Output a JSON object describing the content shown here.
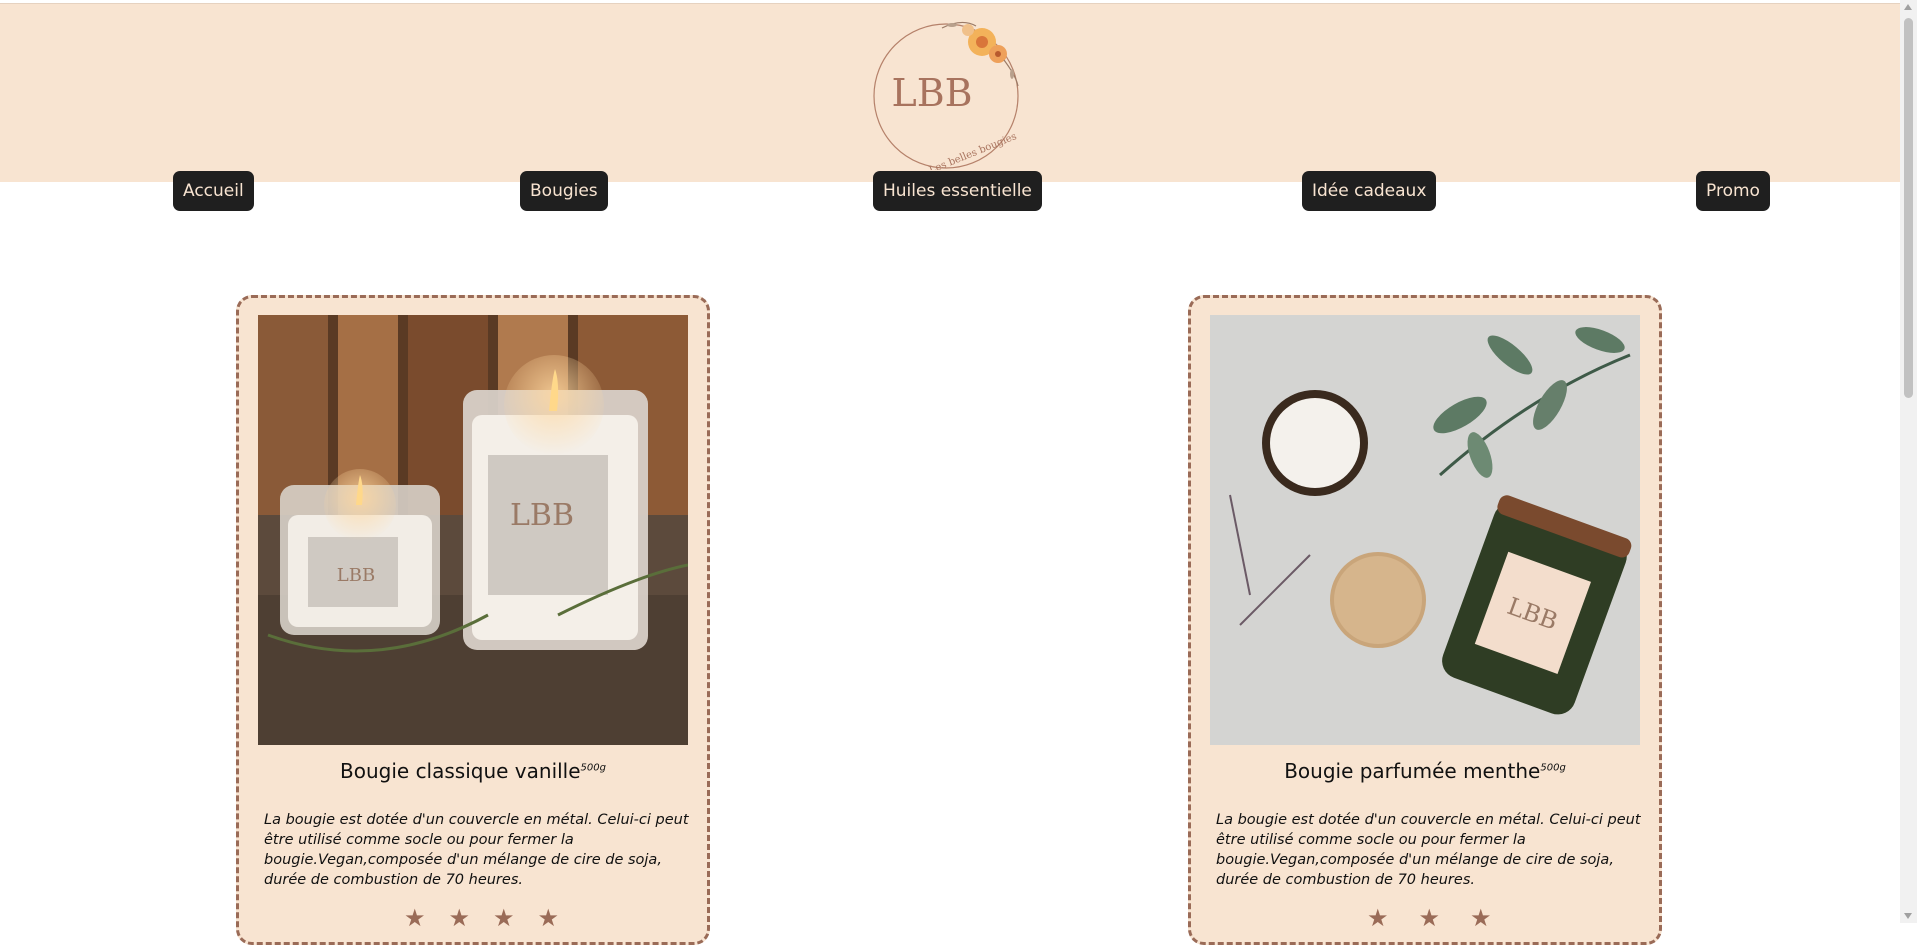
{
  "header": {
    "logo": {
      "monogram": "LBB",
      "tagline": "Les belles bougies"
    }
  },
  "nav": [
    {
      "label": "Accueil"
    },
    {
      "label": "Bougies"
    },
    {
      "label": "Huiles essentielle"
    },
    {
      "label": "Idée cadeaux"
    },
    {
      "label": "Promo"
    }
  ],
  "products": [
    {
      "title": "Bougie classique vanille",
      "weight": "500g",
      "description": "La bougie est dotée d'un couvercle en métal. Celui-ci peut être utilisé comme socle ou pour fermer la bougie.Vegan,composée d'un mélange de cire de soja, durée de combustion de 70 heures.",
      "image_label": "LBB",
      "stars": [
        "★",
        "★",
        "★",
        "★"
      ]
    },
    {
      "title": "Bougie parfumée menthe",
      "weight": "500g",
      "description": "La bougie est dotée d'un couvercle en métal. Celui-ci peut être utilisé comme socle ou pour fermer la bougie.Vegan,composée d'un mélange de cire de soja, durée de combustion de 70 heures.",
      "image_label": "LBB",
      "stars": [
        "★",
        "★",
        "★"
      ]
    }
  ],
  "colors": {
    "header_bg": "#f8e4d1",
    "card_bg": "#f8e4d1",
    "nav_bg": "#1f1f1f",
    "accent_brown": "#9a6b57"
  },
  "icons": [
    "scroll-up-arrow-icon",
    "scroll-down-arrow-icon",
    "star-icon",
    "flower-icon"
  ]
}
